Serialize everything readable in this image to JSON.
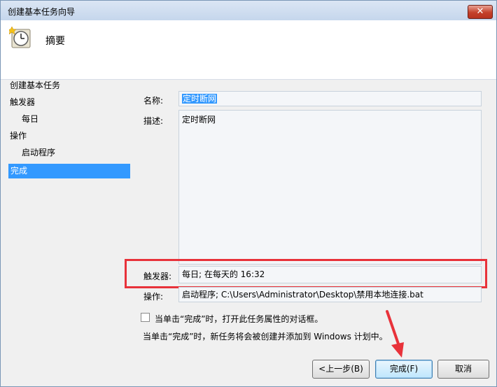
{
  "window": {
    "title": "创建基本任务向导",
    "close_glyph": "✕"
  },
  "header": {
    "icon": "clock-icon",
    "title": "摘要"
  },
  "sidebar": {
    "items": [
      {
        "label": "创建基本任务"
      },
      {
        "label": "触发器"
      },
      {
        "label": "每日"
      },
      {
        "label": "操作"
      },
      {
        "label": "启动程序"
      },
      {
        "label": "完成"
      }
    ],
    "selected_index": 5,
    "selected_color": "#3399ff"
  },
  "form": {
    "name_label": "名称:",
    "name_value": "定时断网",
    "desc_label": "描述:",
    "desc_value": "定时断网",
    "trigger_label": "触发器:",
    "trigger_value": "每日; 在每天的 16:32",
    "action_label": "操作:",
    "action_value": "启动程序; C:\\Users\\Administrator\\Desktop\\禁用本地连接.bat"
  },
  "options": {
    "open_props_label": "当单击“完成”时，打开此任务属性的对话框。",
    "open_props_checked": false,
    "info_text": "当单击“完成”时，新任务将会被创建并添加到 Windows 计划中。"
  },
  "buttons": {
    "back": "<上一步(B)",
    "finish": "完成(F)",
    "cancel": "取消"
  },
  "annotation": {
    "highlight_color": "#e8323a"
  }
}
